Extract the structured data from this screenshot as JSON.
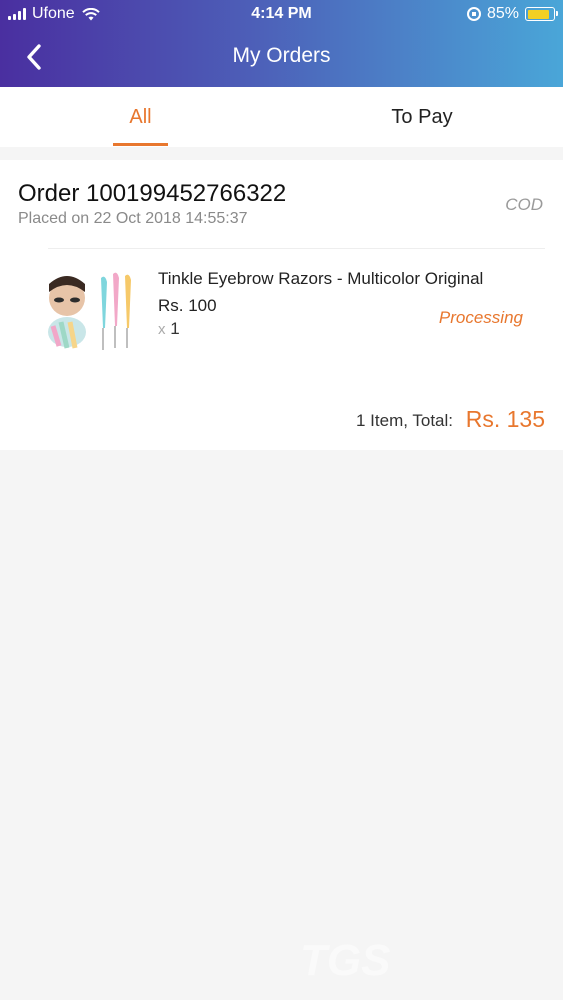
{
  "status_bar": {
    "carrier": "Ufone",
    "time": "4:14 PM",
    "battery": "85%",
    "battery_level": 0.85,
    "icons": [
      "signal-icon",
      "wifi-icon",
      "rotation-lock-icon",
      "battery-icon"
    ]
  },
  "header": {
    "title": "My Orders",
    "back_icon": "chevron-left-icon"
  },
  "tabs": [
    {
      "label": "All",
      "active": true
    },
    {
      "label": "To Pay",
      "active": false
    }
  ],
  "order": {
    "number_label": "Order 100199452766322",
    "placed": "Placed on 22 Oct 2018  14:55:37",
    "payment_method": "COD",
    "item": {
      "name": "Tinkle Eyebrow Razors - Multicolor Original",
      "price": "Rs. 100",
      "qty_prefix": "x",
      "qty": "1",
      "status": "Processing"
    },
    "total_label": "1 Item, Total:",
    "total_value": "Rs. 135"
  },
  "colors": {
    "accent": "#e8772e",
    "header_start": "#4a2fa0",
    "header_end": "#4aa6d8"
  }
}
